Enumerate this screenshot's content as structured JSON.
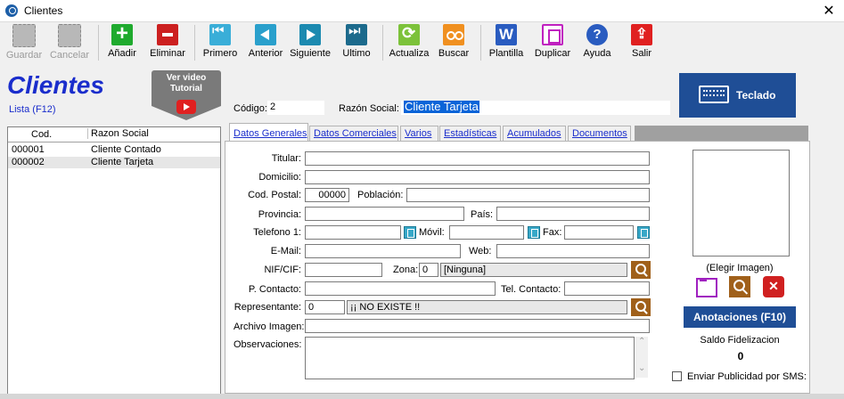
{
  "window": {
    "title": "Clientes",
    "close": "✕"
  },
  "toolbar": [
    {
      "label": "Guardar",
      "icon": "save-icon",
      "enabled": false,
      "color": "#9a9a9a"
    },
    {
      "label": "Cancelar",
      "icon": "cancel-icon",
      "enabled": false,
      "color": "#9a9a9a"
    },
    {
      "label": "Añadir",
      "icon": "plus-icon",
      "enabled": true,
      "color": "#1faa2e"
    },
    {
      "label": "Eliminar",
      "icon": "minus-icon",
      "enabled": true,
      "color": "#cc2020"
    },
    {
      "label": "Primero",
      "icon": "first-icon",
      "enabled": true,
      "color": "#3aaed8"
    },
    {
      "label": "Anterior",
      "icon": "prev-icon",
      "enabled": true,
      "color": "#2aa0cc"
    },
    {
      "label": "Siguiente",
      "icon": "next-icon",
      "enabled": true,
      "color": "#1c8ab0"
    },
    {
      "label": "Ultimo",
      "icon": "last-icon",
      "enabled": true,
      "color": "#1c6a8c"
    },
    {
      "label": "Actualiza",
      "icon": "refresh-icon",
      "enabled": true,
      "color": "#7cc23a"
    },
    {
      "label": "Buscar",
      "icon": "binoculars-icon",
      "enabled": true,
      "color": "#f09020"
    },
    {
      "label": "Plantilla",
      "icon": "word-icon",
      "enabled": true,
      "color": "#2a5cc0"
    },
    {
      "label": "Duplicar",
      "icon": "duplicate-icon",
      "enabled": true,
      "color": "#c020c0"
    },
    {
      "label": "Ayuda",
      "icon": "help-icon",
      "enabled": true,
      "color": "#2a5cc0"
    },
    {
      "label": "Salir",
      "icon": "exit-icon",
      "enabled": true,
      "color": "#e02020"
    }
  ],
  "header": {
    "title": "Clientes",
    "list_link": "Lista (F12)",
    "video_btn": {
      "line1": "Ver video",
      "line2": "Tutorial"
    },
    "codigo_label": "Código:",
    "codigo_value": "2",
    "razon_label": "Razón Social:",
    "razon_value": "Cliente Tarjeta",
    "teclado_label": "Teclado"
  },
  "list": {
    "columns": [
      "Cod.",
      "Razon Social"
    ],
    "rows": [
      {
        "cod": "000001",
        "name": "Cliente Contado"
      },
      {
        "cod": "000002",
        "name": "Cliente Tarjeta"
      }
    ]
  },
  "tabs": [
    "Datos Generales",
    "Datos Comerciales",
    "Varios",
    "Estadísticas",
    "Acumulados",
    "Documentos"
  ],
  "form": {
    "titular": "Titular:",
    "domicilio": "Domicilio:",
    "cod_postal": "Cod. Postal:",
    "cod_postal_value": "00000",
    "poblacion": "Población:",
    "provincia": "Provincia:",
    "pais": "País:",
    "telefono": "Telefono 1:",
    "movil": "Móvil:",
    "fax": "Fax:",
    "email": "E-Mail:",
    "web": "Web:",
    "nif": "NIF/CIF:",
    "zona": "Zona:",
    "zona_value": "0",
    "zona_name": "[Ninguna]",
    "p_contacto": "P. Contacto:",
    "tel_contacto": "Tel. Contacto:",
    "representante": "Representante:",
    "representante_value": "0",
    "representante_name": "¡¡ NO EXISTE !!",
    "archivo_imagen": "Archivo Imagen:",
    "observaciones": "Observaciones:"
  },
  "side": {
    "elegir_imagen": "(Elegir Imagen)",
    "anotaciones": "Anotaciones (F10)",
    "saldo_label": "Saldo Fidelizacion",
    "saldo_value": "0",
    "sms_label": "Enviar Publicidad por SMS:"
  }
}
